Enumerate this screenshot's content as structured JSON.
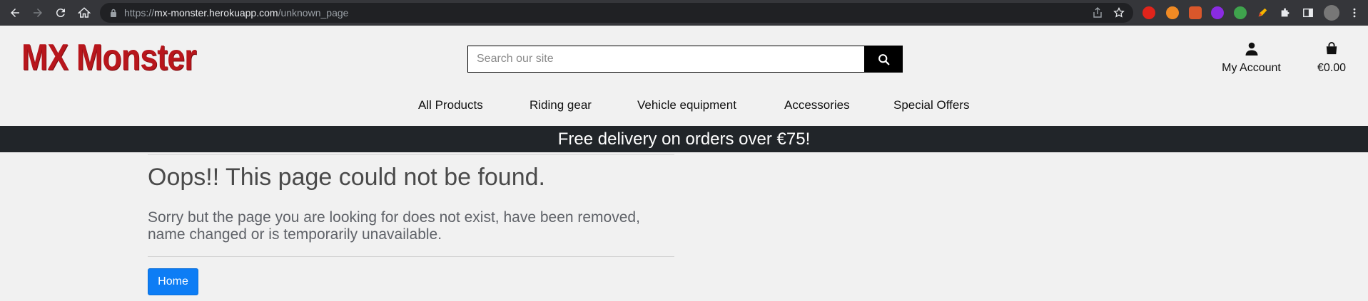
{
  "browser": {
    "url_scheme": "https://",
    "url_host": "mx-monster.herokuapp.com",
    "url_path": "/unknown_page"
  },
  "site": {
    "logo_text": "MX Monster",
    "search": {
      "placeholder": "Search our site"
    },
    "account_label": "My Account",
    "bag_total": "€0.00",
    "nav": [
      {
        "label": "All Products"
      },
      {
        "label": "Riding gear"
      },
      {
        "label": "Vehicle equipment"
      },
      {
        "label": "Accessories"
      },
      {
        "label": "Special Offers"
      }
    ],
    "banner": "Free delivery on orders over €75!"
  },
  "content": {
    "title": "Oops!! This page could not be found.",
    "message": "Sorry but the page you are looking for does not exist, have been removed, name changed or is temporarily unavailable.",
    "home_button": "Home"
  },
  "colors": {
    "brand": "#b8161c",
    "banner_bg": "#212529",
    "primary_button": "#0d7df5"
  }
}
